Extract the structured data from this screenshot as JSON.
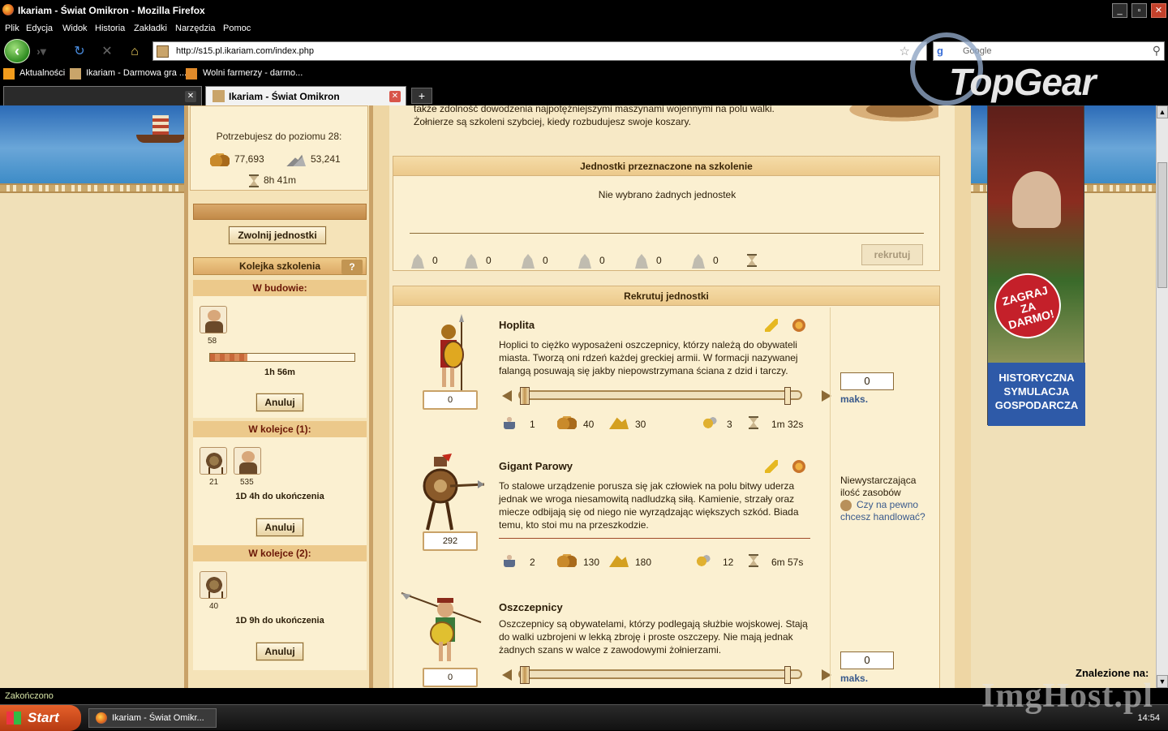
{
  "window": {
    "title": "Ikariam - Świat Omikron - Mozilla Firefox",
    "minimize": "_",
    "maximize": "▫",
    "close": "✕"
  },
  "menu": [
    "Plik",
    "Edycja",
    "Widok",
    "Historia",
    "Zakładki",
    "Narzędzia",
    "Pomoc"
  ],
  "nav": {
    "url": "http://s15.pl.ikariam.com/index.php",
    "search_placeholder": "Google"
  },
  "bookmarks": [
    "Aktualności",
    "Ikariam - Darmowa gra ...",
    "Wolni farmerzy - darmo..."
  ],
  "tabs": [
    {
      "label": "",
      "active": false
    },
    {
      "label": "Ikariam - Świat Omikron",
      "active": true
    }
  ],
  "brand": "TopGear",
  "left": {
    "need_label": "Potrzebujesz do poziomu 28:",
    "wood": "77,693",
    "marble": "53,241",
    "time": "8h 41m",
    "release_btn": "Zwolnij jednostki",
    "queue_title": "Kolejka szkolenia",
    "help": "?",
    "in_progress": "W budowie:",
    "in_progress_count": "58",
    "in_progress_progress": 0.26,
    "in_progress_time": "1h 56m",
    "cancel1": "Anuluj",
    "queue1_title": "W kolejce (1):",
    "queue1_counts": [
      "21",
      "535"
    ],
    "queue1_time": "1D 4h do ukończenia",
    "cancel2": "Anuluj",
    "queue2_title": "W kolejce (2):",
    "queue2_count": "40",
    "queue2_time": "1D 9h do ukończenia",
    "cancel3": "Anuluj"
  },
  "main": {
    "intro": "także zdolność dowodzenia najpotężniejszymi maszynami wojennymi na polu walki. Żołnierze są szkoleni szybciej, kiedy rozbudujesz swoje koszary.",
    "to_train_title": "Jednostki przeznaczone na szkolenie",
    "none_selected": "Nie wybrano żadnych jednostek",
    "totals": [
      "0",
      "0",
      "0",
      "0",
      "0",
      "0"
    ],
    "recruit_btn": "rekrutuj",
    "recruit_title": "Rekrutuj jednostki",
    "units": [
      {
        "name": "Hoplita",
        "desc": "Hoplici to ciężko wyposażeni oszczepnicy, którzy należą do obywateli miasta. Tworzą oni rdzeń każdej greckiej armii. W formacji nazywanej falangą posuwają się jakby niepowstrzymana ściana z dzid i tarczy.",
        "owned": "0",
        "pop": "1",
        "wood": "40",
        "sulfur": "30",
        "upkeep": "3",
        "time": "1m 32s",
        "input": "0",
        "max": "maks."
      },
      {
        "name": "Gigant Parowy",
        "desc": "To stalowe urządzenie porusza się jak człowiek na polu bitwy uderza jednak we wroga niesamowitą nadludzką siłą. Kamienie, strzały oraz miecze odbijają się od niego nie wyrządzając większych szkód. Biada temu, kto stoi mu na przeszkodzie.",
        "owned": "292",
        "pop": "2",
        "wood": "130",
        "sulfur": "180",
        "upkeep": "12",
        "time": "6m 57s",
        "insufficient": "Niewystarczająca ilość zasobów",
        "trade_link": "Czy na pewno chcesz handlować?"
      },
      {
        "name": "Oszczepnicy",
        "desc": "Oszczepnicy są obywatelami, którzy podlegają służbie wojskowej. Stają do walki uzbrojeni w lekką zbroję i proste oszczepy. Nie mają jednak żadnych szans w walce z zawodowymi żołnierzami.",
        "owned": "0",
        "input": "0",
        "max": "maks."
      }
    ]
  },
  "ad": {
    "badge": "ZAGRAJ ZA DARMO!",
    "bottom": "HISTORYCZNA SYMULACJA GOSPODARCZA"
  },
  "status": "Zakończono",
  "find_label": "Znalezione na:",
  "taskbar": {
    "start": "Start",
    "task": "Ikariam - Świat Omikr...",
    "clock": "14:54"
  },
  "watermark": "ImgHost.pl"
}
